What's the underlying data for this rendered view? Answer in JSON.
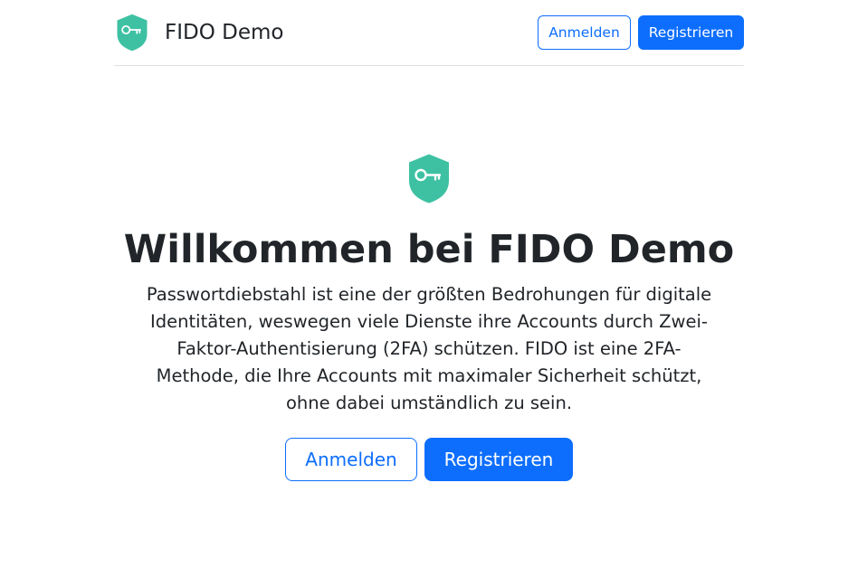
{
  "header": {
    "brand_name": "FIDO Demo",
    "logo_icon": "shield-key-icon",
    "login_label": "Anmelden",
    "register_label": "Registrieren"
  },
  "hero": {
    "logo_icon": "shield-key-icon",
    "title": "Willkommen bei FIDO Demo",
    "lead": "Passwortdiebstahl ist eine der größten Bedrohungen für digitale Identitäten, weswegen viele Dienste ihre Accounts durch Zwei-Faktor-Authentisierung (2FA) schützen. FIDO ist eine 2FA-Methode, die Ihre Accounts mit maximaler Sicherheit schützt, ohne dabei umständlich zu sein.",
    "login_label": "Anmelden",
    "register_label": "Registrieren"
  },
  "colors": {
    "accent": "#0d6efd",
    "logo": "#3ec1a3",
    "text": "#212529",
    "divider": "#dee2e6"
  }
}
